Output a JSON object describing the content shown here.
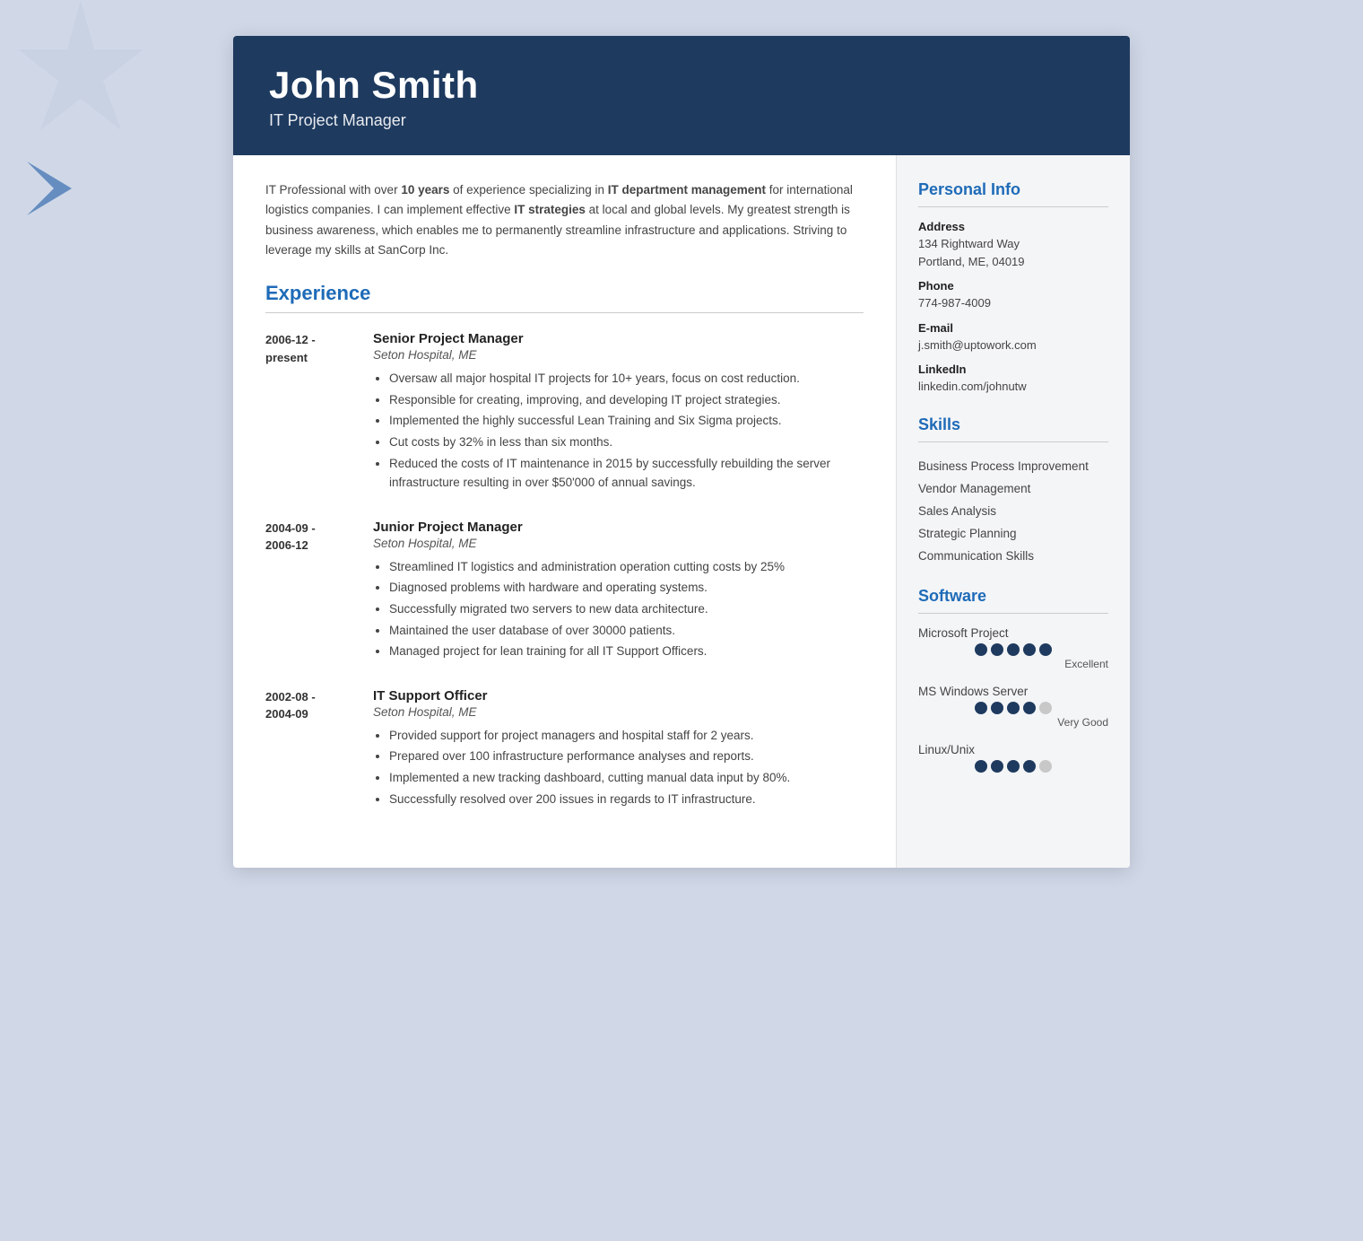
{
  "header": {
    "name": "John Smith",
    "title": "IT Project Manager"
  },
  "summary": {
    "text_parts": [
      {
        "text": "IT Professional with over ",
        "bold": false
      },
      {
        "text": "10 years",
        "bold": true
      },
      {
        "text": " of experience specializing in ",
        "bold": false
      },
      {
        "text": "IT department management",
        "bold": true
      },
      {
        "text": " for international logistics companies. I can implement effective ",
        "bold": false
      },
      {
        "text": "IT strategies",
        "bold": true
      },
      {
        "text": " at local and global levels. My greatest strength is business awareness, which enables me to permanently streamline infrastructure and applications. Striving to leverage my skills at SanCorp Inc.",
        "bold": false
      }
    ]
  },
  "experience": {
    "section_title": "Experience",
    "entries": [
      {
        "date_start": "2006-12 -",
        "date_end": "present",
        "job_title": "Senior Project Manager",
        "company": "Seton Hospital, ME",
        "bullets": [
          "Oversaw all major hospital IT projects for 10+ years, focus on cost reduction.",
          "Responsible for creating, improving, and developing IT project strategies.",
          "Implemented the highly successful Lean Training and Six Sigma projects.",
          "Cut costs by 32% in less than six months.",
          "Reduced the costs of IT maintenance in 2015 by successfully rebuilding the server infrastructure resulting in over $50'000 of annual savings."
        ]
      },
      {
        "date_start": "2004-09 -",
        "date_end": "2006-12",
        "job_title": "Junior Project Manager",
        "company": "Seton Hospital, ME",
        "bullets": [
          "Streamlined IT logistics and administration operation cutting costs by 25%",
          "Diagnosed problems with hardware and operating systems.",
          "Successfully migrated two servers to new data architecture.",
          "Maintained the user database of over 30000 patients.",
          "Managed project for lean training for all IT Support Officers."
        ]
      },
      {
        "date_start": "2002-08 -",
        "date_end": "2004-09",
        "job_title": "IT Support Officer",
        "company": "Seton Hospital, ME",
        "bullets": [
          "Provided support for project managers and hospital staff for 2 years.",
          "Prepared over 100 infrastructure performance analyses and reports.",
          "Implemented a new tracking dashboard, cutting manual data input by 80%.",
          "Successfully resolved over 200 issues in regards to IT infrastructure."
        ]
      }
    ]
  },
  "sidebar": {
    "personal_info": {
      "section_title": "Personal Info",
      "fields": [
        {
          "label": "Address",
          "value": "134 Rightward Way\nPortland, ME, 04019"
        },
        {
          "label": "Phone",
          "value": "774-987-4009"
        },
        {
          "label": "E-mail",
          "value": "j.smith@uptowork.com"
        },
        {
          "label": "LinkedIn",
          "value": "linkedin.com/johnutw"
        }
      ]
    },
    "skills": {
      "section_title": "Skills",
      "items": [
        "Business Process Improvement",
        "Vendor Management",
        "Sales Analysis",
        "Strategic Planning",
        "Communication Skills"
      ]
    },
    "software": {
      "section_title": "Software",
      "items": [
        {
          "name": "Microsoft Project",
          "filled_dots": 5,
          "total_dots": 5,
          "rating_label": "Excellent"
        },
        {
          "name": "MS Windows Server",
          "filled_dots": 4,
          "total_dots": 5,
          "rating_label": "Very Good"
        },
        {
          "name": "Linux/Unix",
          "filled_dots": 4,
          "total_dots": 5,
          "rating_label": ""
        }
      ]
    }
  }
}
